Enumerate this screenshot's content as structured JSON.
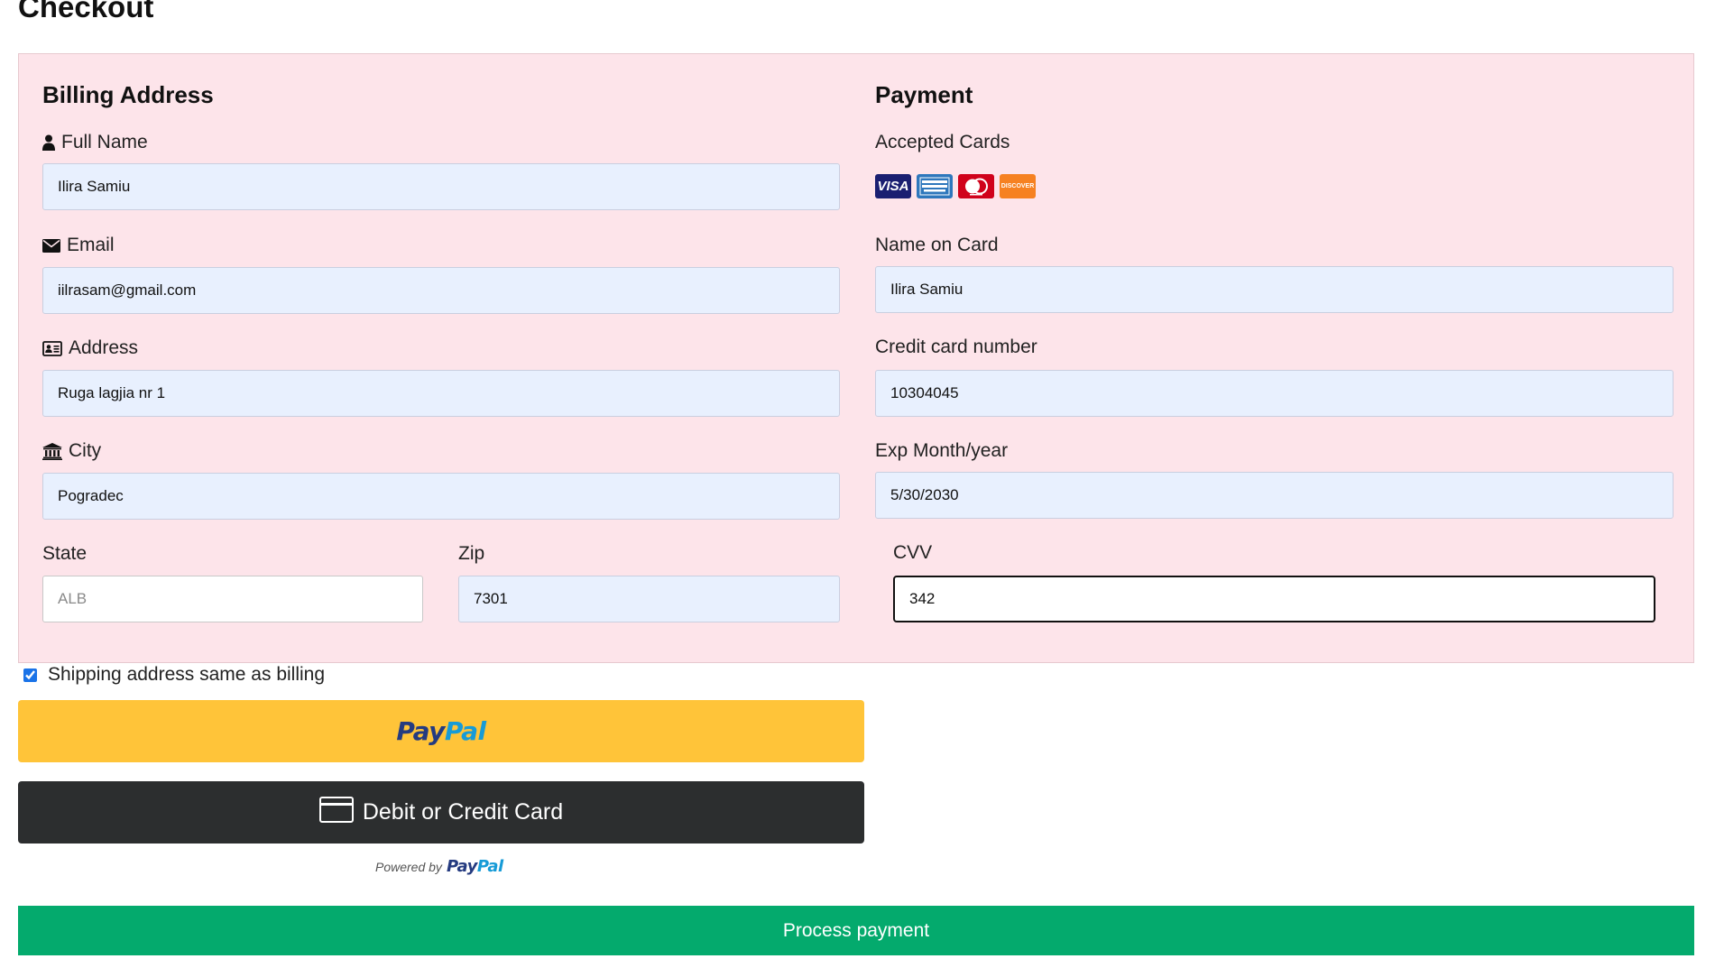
{
  "page": {
    "title": "Checkout"
  },
  "billing": {
    "title": "Billing Address",
    "full_name": {
      "label": "Full Name",
      "value": "Ilira Samiu",
      "icon": "user-icon"
    },
    "email": {
      "label": "Email",
      "value": "iilrasam@gmail.com",
      "icon": "envelope-icon"
    },
    "address": {
      "label": "Address",
      "value": "Ruga lagjia nr 1",
      "icon": "address-card-icon"
    },
    "city": {
      "label": "City",
      "value": "Pogradec",
      "icon": "institution-icon"
    },
    "state": {
      "label": "State",
      "value": "",
      "placeholder": "ALB"
    },
    "zip": {
      "label": "Zip",
      "value": "7301"
    }
  },
  "payment": {
    "title": "Payment",
    "accepted_cards_label": "Accepted Cards",
    "cards": [
      {
        "name": "VISA",
        "icon": "visa-icon",
        "color": "#1a1f71"
      },
      {
        "name": "American Express",
        "icon": "amex-icon",
        "color": "#2e77bc"
      },
      {
        "name": "Mastercard",
        "icon": "mastercard-icon",
        "color": "#d0021b"
      },
      {
        "name": "DISCOVER",
        "icon": "discover-icon",
        "color": "#f68121"
      }
    ],
    "name_on_card": {
      "label": "Name on Card",
      "value": "Ilira Samiu"
    },
    "card_number": {
      "label": "Credit card number",
      "value": "10304045"
    },
    "exp": {
      "label": "Exp Month/year",
      "value": "5/30/2030"
    },
    "cvv": {
      "label": "CVV",
      "value": "342"
    }
  },
  "shipping_same": {
    "label": "Shipping address same as billing",
    "checked": true
  },
  "paypal": {
    "logo_pay": "Pay",
    "logo_pal": "Pal",
    "card_button_label": "Debit or Credit Card",
    "powered_by": "Powered by",
    "colors": {
      "paypal_button": "#ffc439",
      "card_button": "#2c2e2f",
      "pay": "#253b80",
      "pal": "#179bd7"
    }
  },
  "submit": {
    "label": "Process payment",
    "color": "#04aa6d"
  },
  "colors": {
    "panel_bg": "#fde4ea",
    "autofill_bg": "#e8f0fe"
  }
}
